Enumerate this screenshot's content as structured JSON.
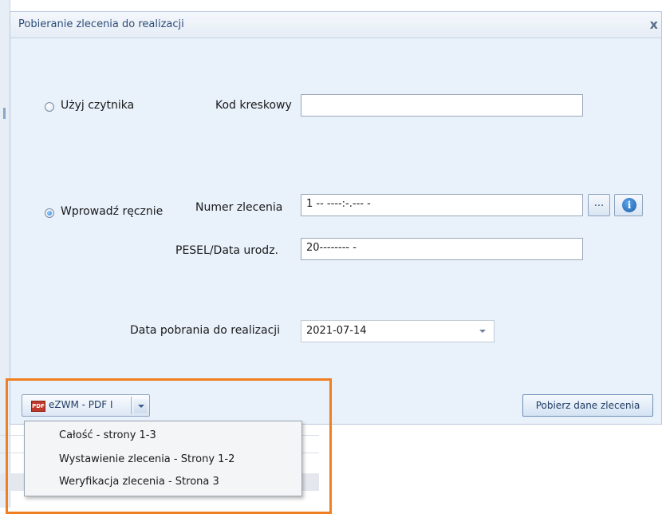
{
  "dialog": {
    "title": "Pobieranie zlecenia do realizacji",
    "close_glyph": "x"
  },
  "reader_option": {
    "label": "Użyj czytnika",
    "selected": false,
    "barcode_label": "Kod kreskowy",
    "barcode_value": ""
  },
  "manual_option": {
    "label": "Wprowadź ręcznie",
    "selected": true,
    "order_number_label": "Numer zlecenia",
    "order_number_value": "1 -- ----:-.--- -",
    "browse_label": "...",
    "info_glyph": "i",
    "pesel_label": "PESEL/Data urodz.",
    "pesel_value": "20-------- -"
  },
  "date_field": {
    "label": "Data pobrania do realizacji",
    "value": "2021-07-14"
  },
  "pdf_button": {
    "label": "eZWM - PDF I",
    "icon_text": "PDF"
  },
  "fetch_button": {
    "label": "Pobierz dane zlecenia"
  },
  "pdf_menu": {
    "items": [
      {
        "label": "Całość - strony 1-3"
      },
      {
        "label": "Wystawienie zlecenia - Strony 1-2"
      },
      {
        "label": "Weryfikacja zlecenia - Strona 3"
      }
    ]
  },
  "colors": {
    "dialog_bg": "#e9f1fb",
    "highlight_border": "#f07f22",
    "title_text": "#2b4c78"
  }
}
